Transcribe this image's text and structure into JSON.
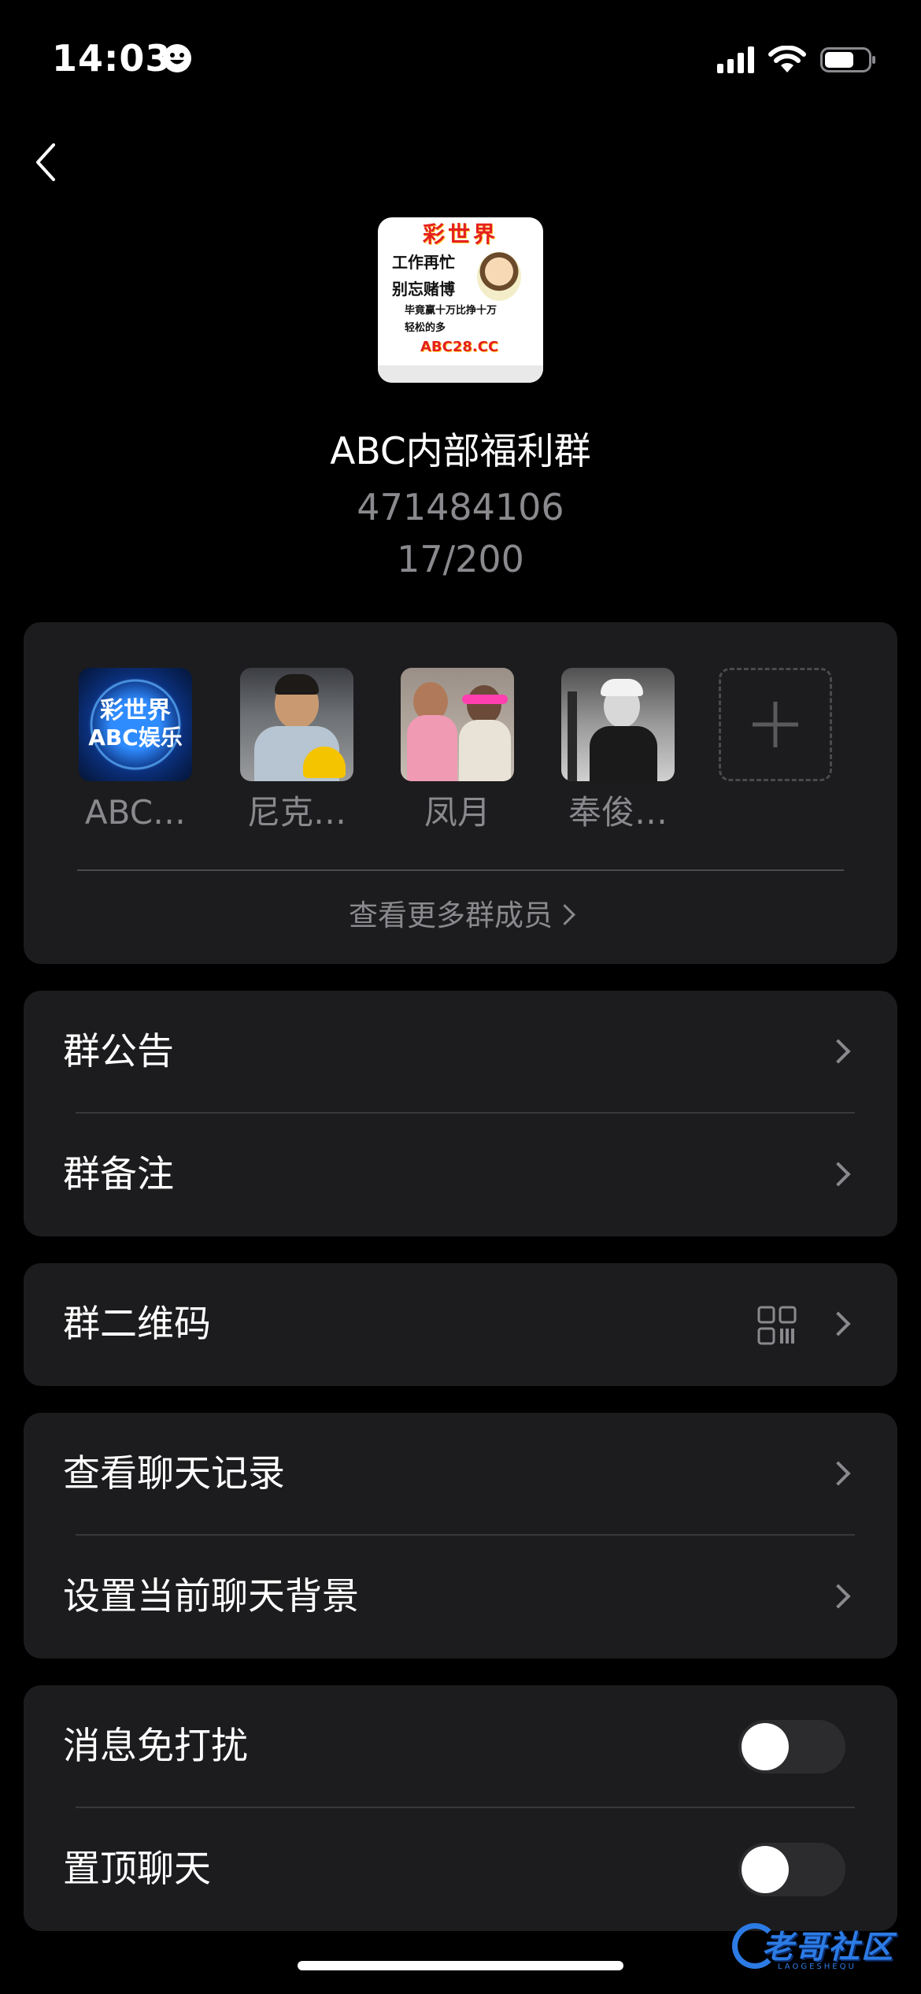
{
  "status_bar": {
    "time": "14:03"
  },
  "header": {
    "avatar_text": {
      "title": "彩世界",
      "line1": "工作再忙",
      "line2": "别忘赌博",
      "line3": "毕竟赢十万比挣十万",
      "line4": "轻松的多",
      "url": "ABC28.CC"
    },
    "group_name": "ABC内部福利群",
    "group_id": "471484106",
    "member_count": "17/200"
  },
  "members": {
    "list": [
      {
        "name": "ABC…",
        "avatar_text": "彩世界\nABC娱乐"
      },
      {
        "name": "尼克…"
      },
      {
        "name": "凤月"
      },
      {
        "name": "奉俊…"
      }
    ],
    "view_more": "查看更多群成员"
  },
  "settings": {
    "announcement": "群公告",
    "remark": "群备注",
    "qrcode": "群二维码",
    "chat_history": "查看聊天记录",
    "chat_background": "设置当前聊天背景",
    "mute": "消息免打扰",
    "pin": "置顶聊天"
  },
  "toggles": {
    "mute_on": false,
    "pin_on": false
  },
  "watermark": {
    "text": "老哥社区",
    "sub": "LAOGESHEQU"
  },
  "colors": {
    "background": "#000000",
    "card": "#1c1c1e",
    "secondary_text": "#8a8a8e",
    "divider": "#38383a"
  }
}
